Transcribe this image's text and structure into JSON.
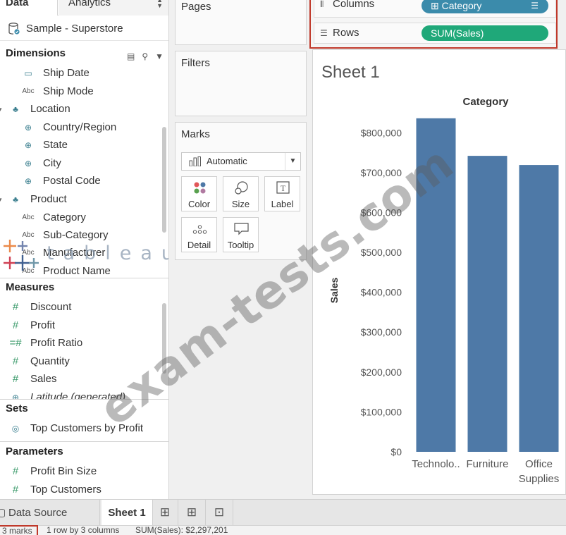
{
  "data_pane": {
    "tab_data": "Data",
    "tab_analytics": "Analytics",
    "datasource": "Sample - Superstore",
    "dimensions_header": "Dimensions",
    "dimensions": [
      {
        "label": "Ship Date",
        "icon": "calendar-icon"
      },
      {
        "label": "Ship Mode",
        "icon": "abc-icon"
      },
      {
        "label": "Location",
        "icon": "hierarchy-icon"
      },
      {
        "label": "Country/Region",
        "icon": "globe-icon"
      },
      {
        "label": "State",
        "icon": "globe-icon"
      },
      {
        "label": "City",
        "icon": "globe-icon"
      },
      {
        "label": "Postal Code",
        "icon": "globe-icon"
      },
      {
        "label": "Product",
        "icon": "hierarchy-icon"
      },
      {
        "label": "Category",
        "icon": "abc-icon"
      },
      {
        "label": "Sub-Category",
        "icon": "abc-icon"
      },
      {
        "label": "Manufacturer",
        "icon": "abc-icon"
      },
      {
        "label": "Product Name",
        "icon": "abc-icon"
      }
    ],
    "measures_header": "Measures",
    "measures": [
      {
        "label": "Discount",
        "icon": "hash-icon"
      },
      {
        "label": "Profit",
        "icon": "hash-icon"
      },
      {
        "label": "Profit Ratio",
        "icon": "calc-hash-icon"
      },
      {
        "label": "Quantity",
        "icon": "hash-icon"
      },
      {
        "label": "Sales",
        "icon": "hash-icon"
      },
      {
        "label": "Latitude (generated)",
        "icon": "globe-icon"
      }
    ],
    "sets_header": "Sets",
    "sets": [
      {
        "label": "Top Customers by Profit",
        "icon": "set-icon"
      }
    ],
    "parameters_header": "Parameters",
    "parameters": [
      {
        "label": "Profit Bin Size",
        "icon": "hash-icon"
      },
      {
        "label": "Top Customers",
        "icon": "hash-icon"
      }
    ],
    "logo_text": "tableau"
  },
  "cards": {
    "pages": "Pages",
    "filters": "Filters",
    "marks": "Marks",
    "mark_type": "Automatic",
    "buttons": [
      "Color",
      "Size",
      "Label",
      "Detail",
      "Tooltip"
    ]
  },
  "shelves": {
    "columns_label": "Columns",
    "columns_pill": "Category",
    "rows_label": "Rows",
    "rows_pill": "SUM(Sales)"
  },
  "view": {
    "sheet_title": "Sheet 1"
  },
  "chart_data": {
    "type": "bar",
    "title": "Category",
    "categories": [
      "Technolo..",
      "Furniture",
      "Office Supplies"
    ],
    "values": [
      836154,
      741999,
      719047
    ],
    "ylabel": "Sales",
    "ylim": [
      0,
      880000
    ],
    "yticks": [
      "$0",
      "$100,000",
      "$200,000",
      "$300,000",
      "$400,000",
      "$500,000",
      "$600,000",
      "$700,000",
      "$800,000"
    ],
    "ytick_values": [
      0,
      100000,
      200000,
      300000,
      400000,
      500000,
      600000,
      700000,
      800000
    ],
    "bar_color": "#4e79a7",
    "grid": false
  },
  "watermark": "exam-tests.com",
  "tabs": {
    "data_source": "Data Source",
    "sheet": "Sheet 1"
  },
  "status": {
    "marks": "3 marks",
    "layout": "1 row by 3 columns",
    "sum": "SUM(Sales): $2,297,201"
  },
  "colors": {
    "pill_dimension": "#3b8bab",
    "pill_measure": "#1fa879",
    "highlight": "#c0392b"
  }
}
